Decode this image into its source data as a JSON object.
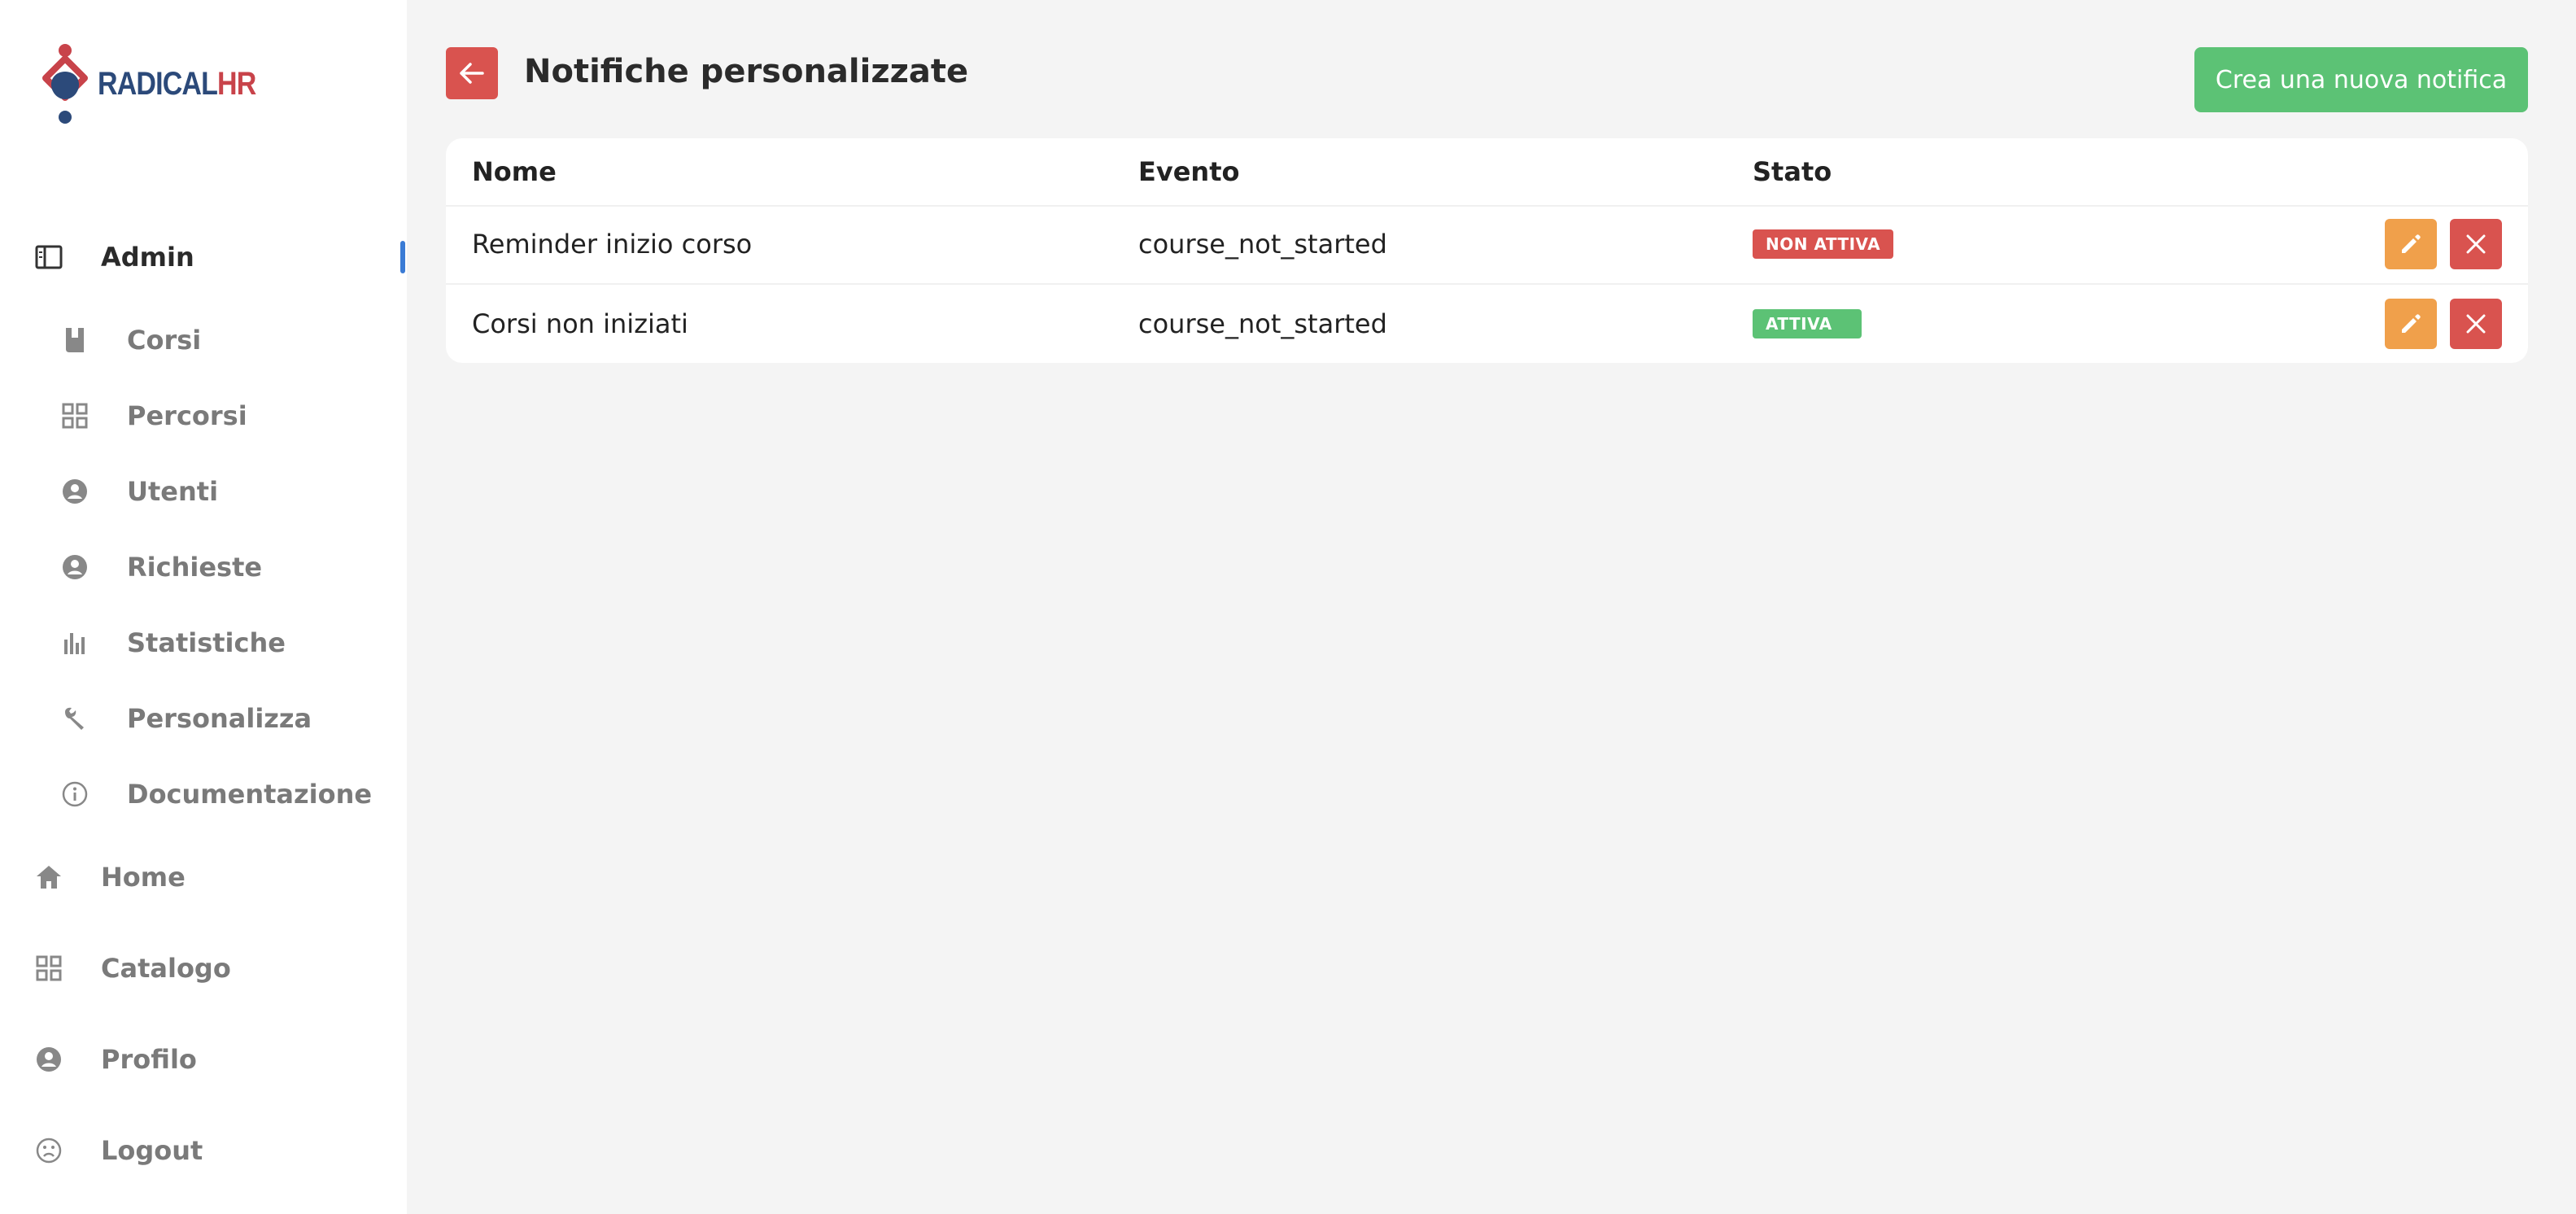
{
  "brand": {
    "part1": "RADICAL",
    "part2": "HR"
  },
  "sidebar": {
    "admin": "Admin",
    "sub_items": [
      {
        "label": "Corsi",
        "icon": "book-icon"
      },
      {
        "label": "Percorsi",
        "icon": "grid-icon"
      },
      {
        "label": "Utenti",
        "icon": "user-circle-icon"
      },
      {
        "label": "Richieste",
        "icon": "user-circle-icon"
      },
      {
        "label": "Statistiche",
        "icon": "bar-chart-icon"
      },
      {
        "label": "Personalizza",
        "icon": "wrench-icon"
      },
      {
        "label": "Documentazione",
        "icon": "info-icon"
      }
    ],
    "bottom_items": [
      {
        "label": "Home",
        "icon": "home-icon"
      },
      {
        "label": "Catalogo",
        "icon": "grid-icon"
      },
      {
        "label": "Profilo",
        "icon": "user-circle-icon"
      },
      {
        "label": "Logout",
        "icon": "sad-face-icon"
      }
    ]
  },
  "header": {
    "title": "Notifiche personalizzate",
    "create_label": "Crea una nuova notifica"
  },
  "table": {
    "columns": [
      "Nome",
      "Evento",
      "Stato"
    ],
    "rows": [
      {
        "name": "Reminder inizio corso",
        "event": "course_not_started",
        "status": "NON ATTIVA"
      },
      {
        "name": "Corsi non iniziati",
        "event": "course_not_started",
        "status": "ATTIVA"
      }
    ]
  },
  "colors": {
    "accent_blue": "#3a7bd5",
    "danger": "#d9534f",
    "success": "#5cc275",
    "warning": "#f0a04b"
  }
}
